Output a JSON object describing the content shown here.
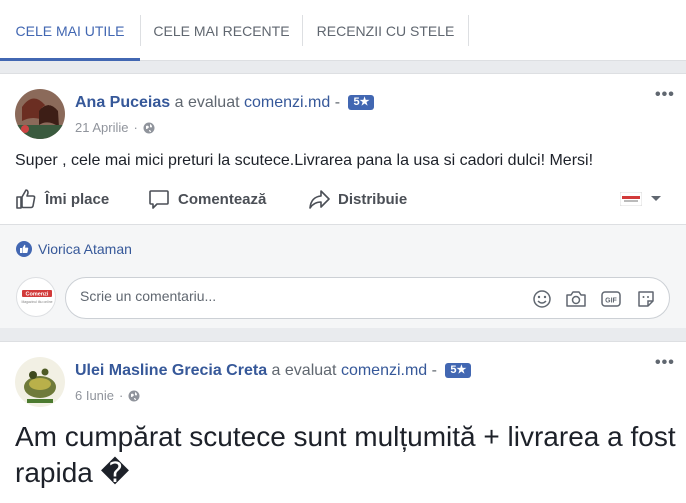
{
  "tabs": [
    {
      "label": "CELE MAI UTILE",
      "active": true
    },
    {
      "label": "CELE MAI RECENTE",
      "active": false
    },
    {
      "label": "RECENZII CU STELE",
      "active": false
    }
  ],
  "reviews": [
    {
      "author": "Ana Puceias",
      "verb": "a evaluat",
      "page": "comenzi.md",
      "dash": "-",
      "rating": "5★",
      "date": "21 Aprilie",
      "date_sep": "·",
      "text": "Super , cele mai mici preturi la scutece.Livrarea pana la usa si cadori dulci! Mersi!",
      "actions": {
        "like": "Îmi place",
        "comment": "Comentează",
        "share": "Distribuie"
      },
      "liked_by": "Viorica Ataman",
      "comment_placeholder": "Scrie un comentariu...",
      "commenter_avatar_text": "Comenzi",
      "commenter_avatar_sub": "Magazinul tău online"
    },
    {
      "author": "Ulei Masline Grecia Creta",
      "verb": "a evaluat",
      "page": "comenzi.md",
      "dash": "-",
      "rating": "5★",
      "date": "6 Iunie",
      "date_sep": "·",
      "text": "Am cumpărat scutece sunt mulțumită + livrarea a fost rapida �"
    }
  ],
  "icons": {
    "more": "more-options-icon",
    "globe": "globe-icon",
    "like": "thumbs-up-icon",
    "comment": "comment-bubble-icon",
    "share": "share-arrow-icon",
    "emoji": "emoji-icon",
    "camera": "camera-icon",
    "gif": "gif-icon",
    "sticker": "sticker-icon"
  },
  "colors": {
    "accent": "#4267b2",
    "link": "#365899",
    "background": "#e9ebee"
  }
}
